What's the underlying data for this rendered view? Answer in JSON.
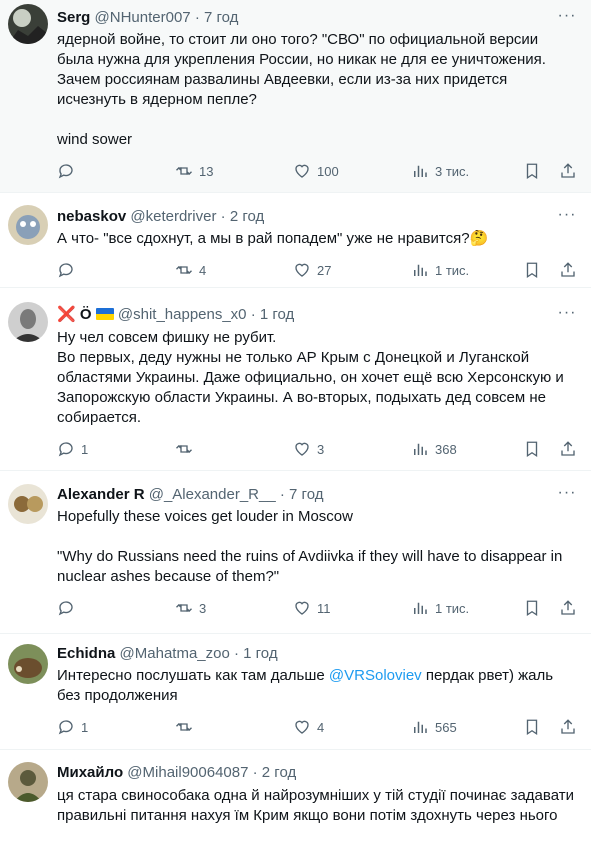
{
  "tweets": [
    {
      "name": "Serg",
      "handle": "@NHunter007",
      "dot": "·",
      "time": "7 год",
      "text": "ядерной войне, то стоит ли оно того? \"СВО\" по официальной версии была нужна для укрепления России, но никак не для ее уничтожения. Зачем россиянам развалины Авдеевки, если из-за них придется исчезнуть в ядерном пепле?\n\nwind sower",
      "replies": "",
      "retweets": "13",
      "likes": "100",
      "views": "3 тис."
    },
    {
      "name": "nebaskov",
      "handle": "@keterdriver",
      "dot": "·",
      "time": "2 год",
      "text": "А что- \"все сдохнут, а мы в рай попадем\" уже не нравится?🤔",
      "replies": "",
      "retweets": "4",
      "likes": "27",
      "views": "1 тис."
    },
    {
      "name_x": "❌",
      "name": "Ö",
      "handle": "@shit_happens_x0",
      "dot": "·",
      "time": "1 год",
      "text": "Ну чел совсем фишку не рубит.\nВо первых, деду нужны не только АР Крым с Донецкой и Луганской областями Украины. Даже официально, он хочет ещё всю Херсонскую и Запорожскую области Украины. А во-вторых, подыхать дед совсем не собирается.",
      "replies": "1",
      "retweets": "",
      "likes": "3",
      "views": "368"
    },
    {
      "name": "Alexander R",
      "handle": "@_Alexander_R__",
      "dot": "·",
      "time": "7 год",
      "text": "Hopefully these voices get louder in Moscow\n\n\"Why do Russians need the ruins of Avdiivka if they will have to disappear in nuclear ashes because of them?\"",
      "replies": "",
      "retweets": "3",
      "likes": "11",
      "views": "1 тис."
    },
    {
      "name": "Echidna",
      "handle": "@Mahatma_zoo",
      "dot": "·",
      "time": "1 год",
      "text_before": "Интересно послушать как там дальше ",
      "mention": "@VRSoloviev",
      "text_after": " пердак рвет) жаль без продолжения",
      "replies": "1",
      "retweets": "",
      "likes": "4",
      "views": "565"
    },
    {
      "name": "Михайло",
      "handle": "@Mihail90064087",
      "dot": "·",
      "time": "2 год",
      "text": "ця стара свинособака одна й найрозумніших у тій студії починає задавати правильні питання нахуя їм Крим якщо вони потім здохнуть через нього"
    }
  ],
  "more_glyph": "···",
  "colors": {
    "text": "#0f1419",
    "secondary": "#536471",
    "link": "#1d9bf0",
    "divider": "#eff3f4",
    "highlight_bg": "#f7f9f9"
  },
  "icons": [
    "reply-icon",
    "retweet-icon",
    "like-icon",
    "views-icon",
    "bookmark-icon",
    "share-icon",
    "more-icon"
  ]
}
